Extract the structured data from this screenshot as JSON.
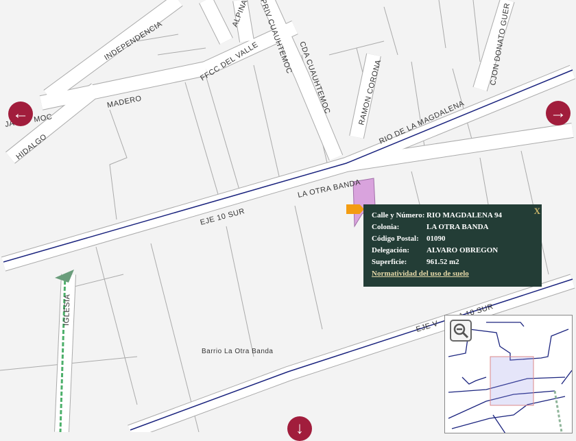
{
  "streets": {
    "independencia": "INDEPENDENCIA",
    "alpina": "ALPINA",
    "priv_cuauhtemoc": "PRIV CUAUHTEMOC",
    "ffcc_del_valle": "FFCC DEL VALLE",
    "cda_cuauhtemoc": "CDA CUAUHTEMOC",
    "ramon_corona": "RAMON CORONA",
    "cjon_donato": "CJON DONATO GUER",
    "madero": "MADERO",
    "ja": "JA",
    "moc": "MOC",
    "hidalgo": "HIDALGO",
    "rio_magdalena": "RIO DE LA MAGDALENA",
    "la_otra_banda": "LA OTRA BANDA",
    "eje_10_sur": "EJE 10 SUR",
    "eje_vial_left": "EJE V",
    "eje_vial_right": "A 10 SUR",
    "iglesia": "IGLESIA",
    "barrio": "Barrio La Otra Banda"
  },
  "popup": {
    "rows": [
      {
        "label": "Calle y Número:",
        "value": "RIO MAGDALENA 94"
      },
      {
        "label": "Colonia:",
        "value": "LA OTRA BANDA"
      },
      {
        "label": "Código Postal:",
        "value": "01090"
      },
      {
        "label": "Delegación:",
        "value": "ALVARO OBREGON"
      },
      {
        "label": "Superficie:",
        "value": "961.52 m2"
      }
    ],
    "link": "Normatividad del uso de suelo",
    "close": "X"
  },
  "colors": {
    "road": "#1a237e",
    "nav": "#a11d3c",
    "popup_bg": "#233d36",
    "parcel": "#d9a3dd",
    "marker": "#f39c12"
  }
}
